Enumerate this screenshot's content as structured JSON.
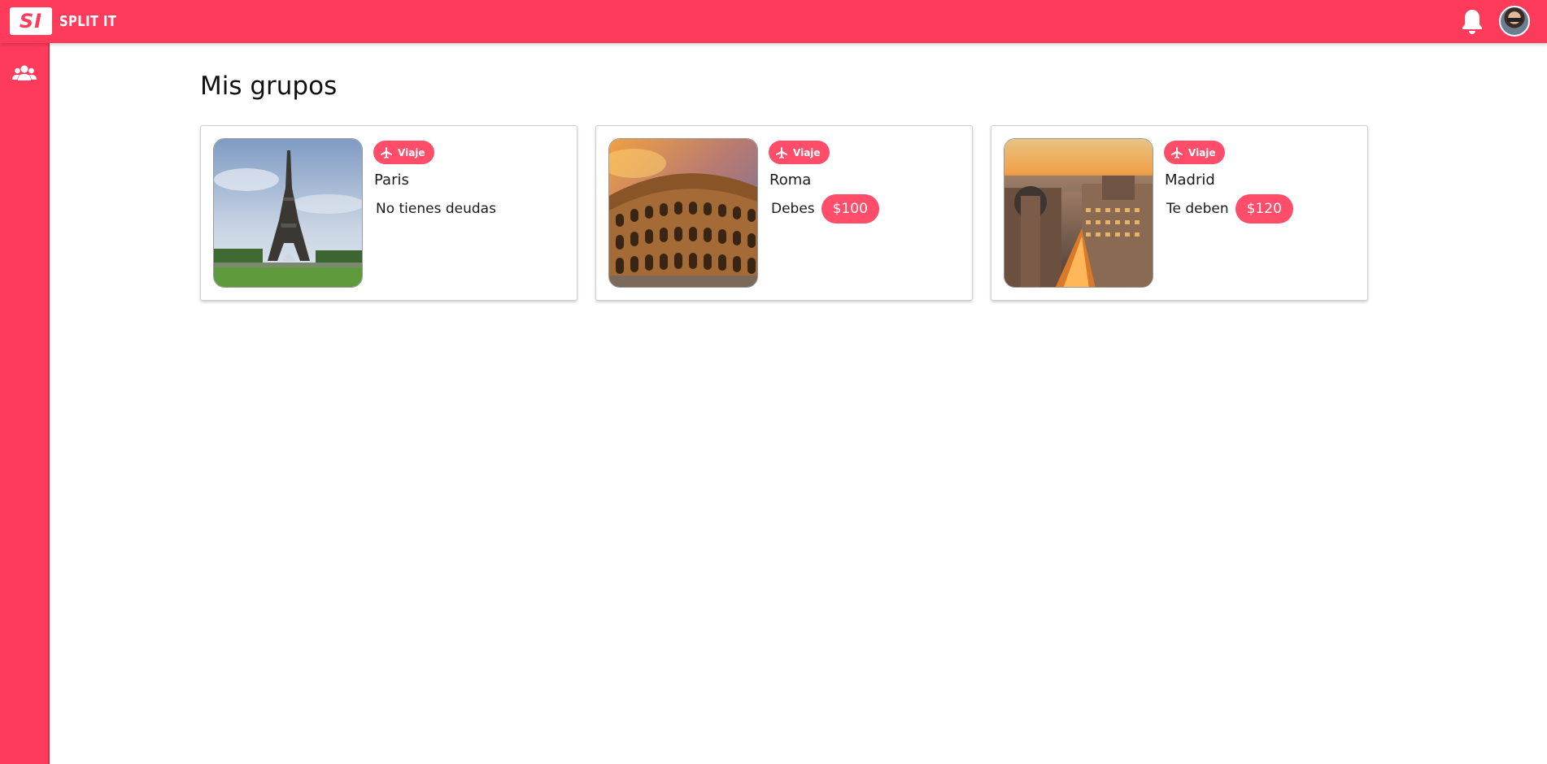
{
  "app": {
    "logo_mark": "SI",
    "name": "SPLIT IT",
    "accent_color": "#ff3b5c"
  },
  "header": {
    "notifications_icon": "bell-icon",
    "avatar_icon": "user-avatar"
  },
  "sidebar": {
    "items": [
      {
        "icon": "groups-icon",
        "label": "Grupos"
      }
    ]
  },
  "main": {
    "title": "Mis grupos",
    "groups": [
      {
        "name": "Paris",
        "category": "Viaje",
        "category_icon": "airplane-icon",
        "image": "eiffel-tower-photo",
        "balance_label": "No tienes deudas",
        "amount": ""
      },
      {
        "name": "Roma",
        "category": "Viaje",
        "category_icon": "airplane-icon",
        "image": "colosseum-photo",
        "balance_label": "Debes",
        "amount": "$100"
      },
      {
        "name": "Madrid",
        "category": "Viaje",
        "category_icon": "airplane-icon",
        "image": "madrid-gran-via-photo",
        "balance_label": "Te deben",
        "amount": "$120"
      }
    ]
  }
}
